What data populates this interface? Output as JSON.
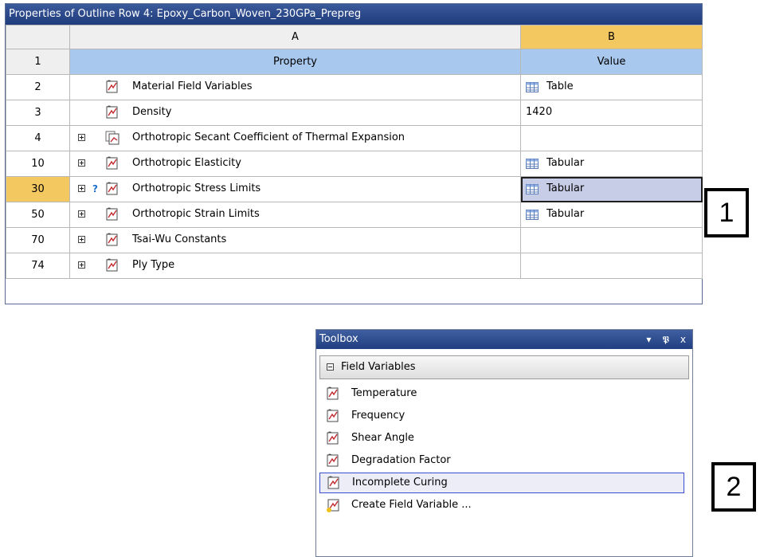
{
  "properties": {
    "title": "Properties of Outline Row 4: Epoxy_Carbon_Woven_230GPa_Prepreg",
    "columns": [
      "A",
      "B"
    ],
    "header": {
      "num": "1",
      "property": "Property",
      "value": "Value"
    },
    "rows": [
      {
        "num": "2",
        "label": "Material Field Variables",
        "value": "Table",
        "expandable": false,
        "value_icon": "table-icon"
      },
      {
        "num": "3",
        "label": "Density",
        "value": "1420",
        "expandable": false,
        "value_icon": ""
      },
      {
        "num": "4",
        "label": "Orthotropic Secant Coefficient of Thermal Expansion",
        "value": "",
        "expandable": true,
        "value_icon": ""
      },
      {
        "num": "10",
        "label": "Orthotropic Elasticity",
        "value": "Tabular",
        "expandable": true,
        "value_icon": "table-icon"
      },
      {
        "num": "30",
        "label": "Orthotropic Stress Limits",
        "value": "Tabular",
        "expandable": true,
        "value_icon": "table-icon",
        "selected": true,
        "help": "?"
      },
      {
        "num": "50",
        "label": "Orthotropic Strain Limits",
        "value": "Tabular",
        "expandable": true,
        "value_icon": "table-icon"
      },
      {
        "num": "70",
        "label": "Tsai-Wu Constants",
        "value": "",
        "expandable": true,
        "value_icon": ""
      },
      {
        "num": "74",
        "label": "Ply Type",
        "value": "",
        "expandable": true,
        "value_icon": ""
      }
    ]
  },
  "callouts": {
    "one": "1",
    "two": "2"
  },
  "toolbox": {
    "title": "Toolbox",
    "controls": {
      "dropdown": "▾",
      "pin": "ᵽ",
      "close": "x"
    },
    "group": "Field Variables",
    "items": [
      "Temperature",
      "Frequency",
      "Shear Angle",
      "Degradation Factor",
      "Incomplete Curing",
      "Create Field Variable ..."
    ],
    "selected_item": "Incomplete Curing"
  },
  "colors": {
    "title_bar": "#2a478a",
    "column_highlight": "#f4c860",
    "header_row": "#a9c8ee",
    "selected_cell": "#c7cde7"
  }
}
